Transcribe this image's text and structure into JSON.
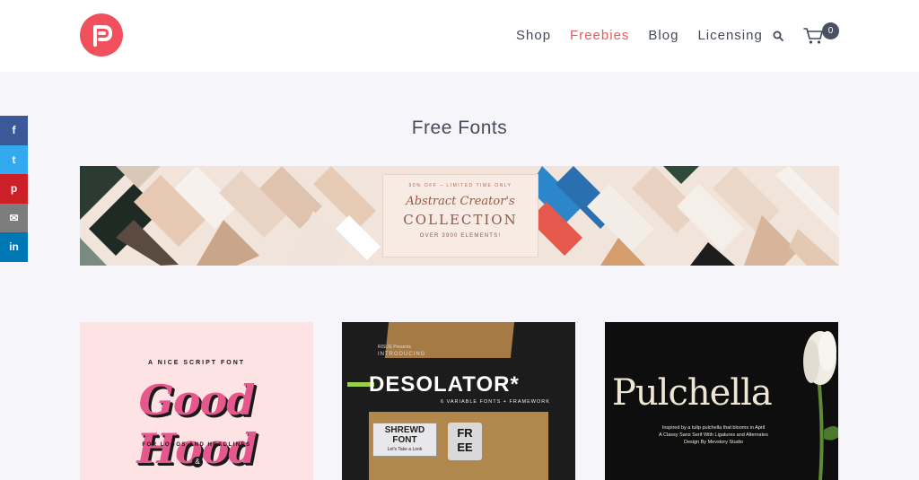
{
  "header": {
    "nav": [
      {
        "label": "Shop",
        "active": false
      },
      {
        "label": "Freebies",
        "active": true
      },
      {
        "label": "Blog",
        "active": false
      },
      {
        "label": "Licensing",
        "active": false
      }
    ],
    "cart_count": "0",
    "brand_color": "#f0505b",
    "active_color": "#ea5a5e"
  },
  "share": {
    "icons": [
      "facebook-icon",
      "twitter-icon",
      "pinterest-icon",
      "email-icon",
      "linkedin-icon"
    ],
    "glyphs": [
      "f",
      "t",
      "p",
      "✉",
      "in"
    ]
  },
  "page": {
    "title": "Free Fonts"
  },
  "banner": {
    "top_text": "90% OFF – LIMITED TIME ONLY",
    "script_text": "Abstract Creator's",
    "main_text": "COLLECTION",
    "sub_text": "OVER 3900 ELEMENTS!"
  },
  "cards": [
    {
      "top": "A NICE SCRIPT FONT",
      "title": "Good Hood",
      "subtitle": "FOR LOGOS AND HEADLINES",
      "mark": "&"
    },
    {
      "presents": "RISLIE Presents",
      "intro": "INTRODUCING",
      "title": "DESOLATOR",
      "star": "*",
      "subtitle": "6 VARIABLE FONTS + FRAMEWORK",
      "box1_title_line1": "SHREWD",
      "box1_title_line2": "FONT",
      "box1_small": "Let's Take a Look",
      "box2_line1": "FR",
      "box2_line2": "EE"
    },
    {
      "title": "Pulchella",
      "line1": "Inspired by a tulip pulchella that blooms in April",
      "line2": "A Classy Sans Serif With Ligatures and Alternates",
      "line3": "Design By Mevstory Studio"
    }
  ]
}
